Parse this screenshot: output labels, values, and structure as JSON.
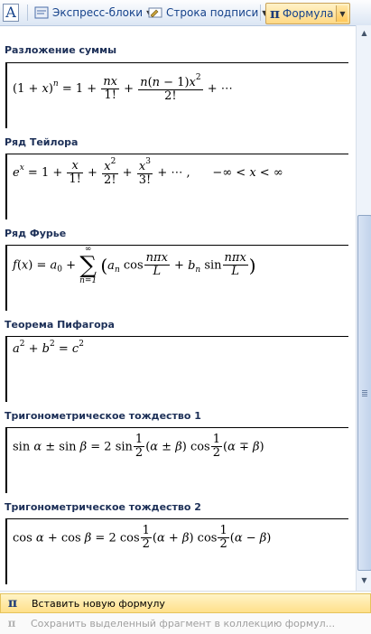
{
  "ribbon": {
    "quick_parts_label": "Экспресс-блоки",
    "signature_line_label": "Строка подписи",
    "formula_label": "Формула"
  },
  "gallery": {
    "sections": [
      {
        "title": "Разложение суммы"
      },
      {
        "title": "Ряд Тейлора"
      },
      {
        "title": "Ряд Фурье"
      },
      {
        "title": "Теорема Пифагора"
      },
      {
        "title": "Тригонометрическое тождество 1"
      },
      {
        "title": "Тригонометрическое тождество 2"
      }
    ]
  },
  "menu": {
    "insert_new": "Вставить новую формулу",
    "save_selection": "Сохранить выделенный фрагмент в коллекцию формул..."
  },
  "colors": {
    "section_title": "#1c2f57",
    "menu_highlight": "#ffe08a",
    "ribbon_text": "#15428b"
  }
}
